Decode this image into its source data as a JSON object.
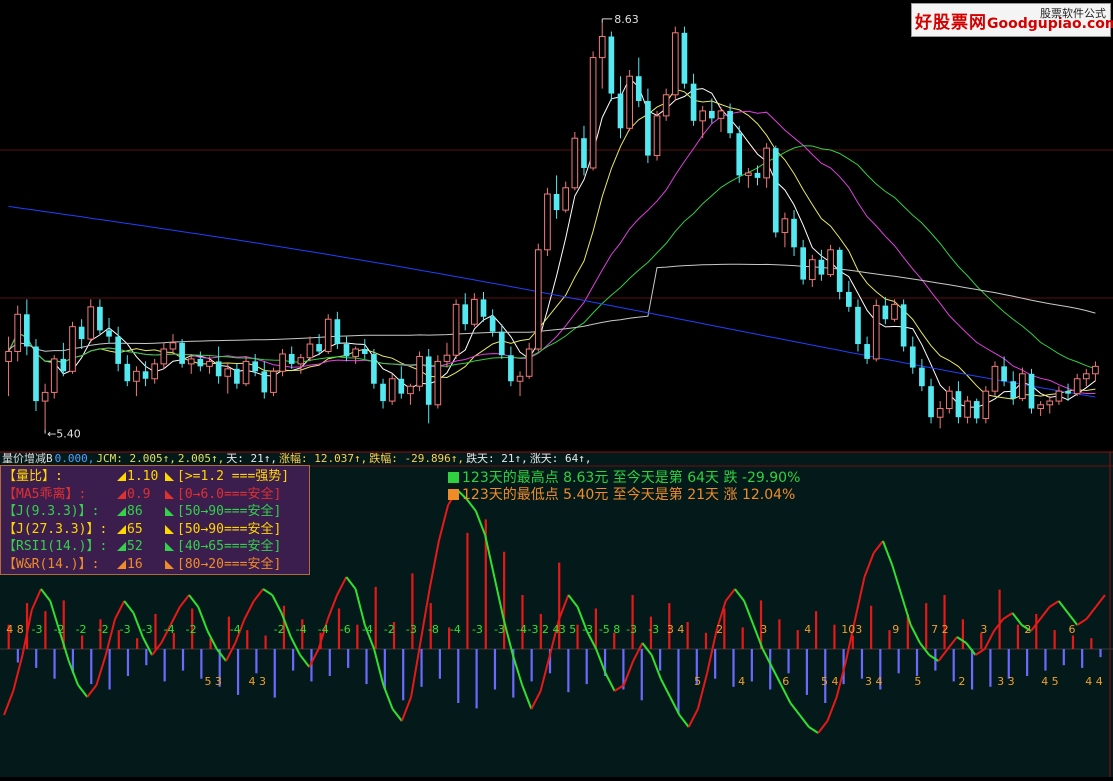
{
  "logo": {
    "text": "好股票网",
    "domain": "Goodgupiao.com",
    "tag": "股票软件公式"
  },
  "price_labels": {
    "high": "8.63",
    "low": "5.40"
  },
  "status_bar": {
    "items": [
      {
        "text": "量价增减B",
        "color": "#dddddd"
      },
      {
        "text": "0.000,",
        "color": "#4aa3ff"
      },
      {
        "text": "JCM: 2.005↑,",
        "color": "#e0e060"
      },
      {
        "text": "2.005↑,",
        "color": "#e0e060"
      },
      {
        "text": "天: 21↑,",
        "color": "#e8e8e8"
      },
      {
        "text": "涨幅: 12.037↑,",
        "color": "#ffd24a"
      },
      {
        "text": "跌幅: -29.896↑,",
        "color": "#ffd24a"
      },
      {
        "text": "跌天: 21↑,",
        "color": "#e8e8e8"
      },
      {
        "text": "涨天: 64↑,",
        "color": "#e8e8e8"
      }
    ]
  },
  "indicator_box": {
    "rows": [
      {
        "label": "【量比】:",
        "value": "1.10",
        "range": "[>=1.2 ===强势]",
        "color": "#ffd700"
      },
      {
        "label": "【MA5乖离】:",
        "value": "0.9",
        "range": "[0→6.0===安全]",
        "color": "#e03030"
      },
      {
        "label": "【J(9.3.3)】:",
        "value": "86",
        "range": "[50→90===安全]",
        "color": "#32d24a"
      },
      {
        "label": "【J(27.3.3)】:",
        "value": "65",
        "range": "[50→90===安全]",
        "color": "#ffd700"
      },
      {
        "label": "【RSI1(14.)】:",
        "value": "52",
        "range": "[40→65===安全]",
        "color": "#32d24a"
      },
      {
        "label": "【W&R(14.)】:",
        "value": "16",
        "range": "[80→20===安全]",
        "color": "#f08c28"
      }
    ]
  },
  "highlights": [
    {
      "text": "123天的最高点 8.63元 至今天是第 64天 跌 -29.90%",
      "color": "#30d040"
    },
    {
      "text": "123天的最低点 5.40元 至今天是第 21天 涨 12.04%",
      "color": "#f08c28"
    }
  ],
  "chart_data": [
    {
      "type": "candlestick",
      "x_count": 120,
      "ohlc": [
        [
          5.9,
          6.1,
          5.62,
          5.98
        ],
        [
          5.98,
          6.35,
          5.9,
          6.28
        ],
        [
          6.28,
          6.4,
          5.95,
          6.02
        ],
        [
          6.02,
          6.08,
          5.5,
          5.58
        ],
        [
          5.58,
          5.72,
          5.35,
          5.65
        ],
        [
          5.65,
          5.95,
          5.6,
          5.92
        ],
        [
          5.92,
          6.05,
          5.78,
          5.82
        ],
        [
          5.82,
          6.22,
          5.8,
          6.18
        ],
        [
          6.18,
          6.24,
          6.0,
          6.08
        ],
        [
          6.08,
          6.4,
          6.05,
          6.34
        ],
        [
          6.34,
          6.4,
          6.12,
          6.15
        ],
        [
          6.15,
          6.25,
          6.05,
          6.1
        ],
        [
          6.1,
          6.18,
          5.82,
          5.88
        ],
        [
          5.88,
          5.95,
          5.7,
          5.74
        ],
        [
          5.74,
          5.86,
          5.62,
          5.82
        ],
        [
          5.82,
          5.9,
          5.7,
          5.76
        ],
        [
          5.76,
          5.92,
          5.72,
          5.88
        ],
        [
          5.88,
          6.05,
          5.84,
          6.0
        ],
        [
          6.0,
          6.12,
          5.96,
          6.05
        ],
        [
          6.05,
          6.08,
          5.85,
          5.88
        ],
        [
          5.88,
          5.96,
          5.8,
          5.92
        ],
        [
          5.92,
          5.98,
          5.82,
          5.86
        ],
        [
          5.86,
          5.94,
          5.8,
          5.9
        ],
        [
          5.9,
          6.02,
          5.72,
          5.78
        ],
        [
          5.78,
          5.88,
          5.64,
          5.84
        ],
        [
          5.84,
          5.88,
          5.68,
          5.72
        ],
        [
          5.72,
          5.94,
          5.7,
          5.9
        ],
        [
          5.9,
          5.96,
          5.78,
          5.82
        ],
        [
          5.82,
          5.9,
          5.6,
          5.65
        ],
        [
          5.65,
          5.85,
          5.62,
          5.82
        ],
        [
          5.82,
          6.0,
          5.78,
          5.96
        ],
        [
          5.96,
          6.02,
          5.84,
          5.88
        ],
        [
          5.88,
          5.96,
          5.8,
          5.93
        ],
        [
          5.93,
          6.1,
          5.9,
          6.04
        ],
        [
          6.04,
          6.12,
          5.95,
          5.98
        ],
        [
          5.98,
          6.28,
          5.96,
          6.24
        ],
        [
          6.24,
          6.3,
          6.0,
          6.04
        ],
        [
          6.04,
          6.1,
          5.9,
          5.94
        ],
        [
          5.94,
          6.02,
          5.88,
          6.0
        ],
        [
          6.0,
          6.08,
          5.92,
          5.96
        ],
        [
          5.96,
          6.0,
          5.68,
          5.72
        ],
        [
          5.72,
          5.76,
          5.52,
          5.58
        ],
        [
          5.58,
          5.8,
          5.55,
          5.76
        ],
        [
          5.76,
          5.86,
          5.6,
          5.64
        ],
        [
          5.64,
          5.72,
          5.55,
          5.7
        ],
        [
          5.7,
          5.98,
          5.66,
          5.94
        ],
        [
          5.94,
          6.0,
          5.4,
          5.55
        ],
        [
          5.55,
          5.95,
          5.52,
          5.9
        ],
        [
          5.9,
          6.05,
          5.85,
          5.95
        ],
        [
          5.95,
          6.4,
          5.92,
          6.36
        ],
        [
          6.36,
          6.45,
          6.15,
          6.2
        ],
        [
          6.2,
          6.45,
          6.18,
          6.4
        ],
        [
          6.4,
          6.46,
          6.22,
          6.26
        ],
        [
          6.26,
          6.32,
          6.1,
          6.14
        ],
        [
          6.14,
          6.2,
          5.92,
          5.95
        ],
        [
          5.95,
          6.02,
          5.7,
          5.74
        ],
        [
          5.74,
          5.82,
          5.62,
          5.78
        ],
        [
          5.78,
          6.05,
          5.76,
          6.0
        ],
        [
          6.0,
          6.85,
          5.98,
          6.8
        ],
        [
          6.8,
          7.3,
          6.75,
          7.25
        ],
        [
          7.25,
          7.4,
          7.05,
          7.12
        ],
        [
          7.12,
          7.35,
          7.1,
          7.3
        ],
        [
          7.3,
          7.75,
          7.28,
          7.7
        ],
        [
          7.7,
          7.8,
          7.4,
          7.46
        ],
        [
          7.46,
          8.4,
          7.44,
          8.35
        ],
        [
          8.35,
          8.63,
          8.1,
          8.52
        ],
        [
          8.52,
          8.56,
          8.0,
          8.06
        ],
        [
          8.06,
          8.2,
          7.7,
          7.78
        ],
        [
          7.78,
          8.25,
          7.76,
          8.2
        ],
        [
          8.2,
          8.35,
          7.95,
          8.0
        ],
        [
          8.0,
          8.1,
          7.5,
          7.56
        ],
        [
          7.56,
          7.92,
          7.52,
          7.88
        ],
        [
          7.88,
          8.1,
          7.84,
          8.05
        ],
        [
          8.05,
          8.6,
          8.0,
          8.55
        ],
        [
          8.55,
          8.6,
          8.1,
          8.14
        ],
        [
          8.14,
          8.22,
          7.8,
          7.84
        ],
        [
          7.84,
          7.96,
          7.7,
          7.92
        ],
        [
          7.92,
          8.02,
          7.82,
          7.86
        ],
        [
          7.86,
          7.95,
          7.75,
          7.92
        ],
        [
          7.92,
          7.98,
          7.7,
          7.74
        ],
        [
          7.74,
          7.8,
          7.34,
          7.4
        ],
        [
          7.4,
          7.46,
          7.3,
          7.42
        ],
        [
          7.42,
          7.48,
          7.32,
          7.38
        ],
        [
          7.38,
          7.66,
          7.3,
          7.62
        ],
        [
          7.62,
          7.64,
          6.9,
          6.94
        ],
        [
          6.94,
          7.1,
          6.82,
          7.05
        ],
        [
          7.05,
          7.12,
          6.75,
          6.82
        ],
        [
          6.82,
          6.88,
          6.52,
          6.56
        ],
        [
          6.56,
          6.76,
          6.5,
          6.72
        ],
        [
          6.72,
          6.8,
          6.55,
          6.6
        ],
        [
          6.6,
          6.84,
          6.58,
          6.8
        ],
        [
          6.8,
          6.82,
          6.4,
          6.46
        ],
        [
          6.46,
          6.55,
          6.3,
          6.34
        ],
        [
          6.34,
          6.4,
          5.98,
          6.04
        ],
        [
          6.04,
          6.1,
          5.88,
          5.92
        ],
        [
          5.92,
          6.4,
          5.9,
          6.35
        ],
        [
          6.35,
          6.42,
          6.2,
          6.24
        ],
        [
          6.24,
          6.4,
          6.22,
          6.36
        ],
        [
          6.36,
          6.4,
          5.98,
          6.02
        ],
        [
          6.02,
          6.1,
          5.8,
          5.85
        ],
        [
          5.85,
          5.92,
          5.66,
          5.7
        ],
        [
          5.7,
          5.76,
          5.4,
          5.45
        ],
        [
          5.45,
          5.58,
          5.36,
          5.52
        ],
        [
          5.52,
          5.7,
          5.48,
          5.66
        ],
        [
          5.66,
          5.74,
          5.4,
          5.45
        ],
        [
          5.45,
          5.62,
          5.4,
          5.58
        ],
        [
          5.58,
          5.6,
          5.4,
          5.44
        ],
        [
          5.44,
          5.7,
          5.4,
          5.66
        ],
        [
          5.66,
          5.9,
          5.62,
          5.86
        ],
        [
          5.86,
          5.94,
          5.7,
          5.74
        ],
        [
          5.74,
          5.82,
          5.55,
          5.6
        ],
        [
          5.6,
          5.85,
          5.58,
          5.8
        ],
        [
          5.8,
          5.84,
          5.48,
          5.52
        ],
        [
          5.52,
          5.58,
          5.46,
          5.55
        ],
        [
          5.55,
          5.62,
          5.48,
          5.58
        ],
        [
          5.58,
          5.7,
          5.55,
          5.66
        ],
        [
          5.66,
          5.72,
          5.58,
          5.64
        ],
        [
          5.64,
          5.8,
          5.62,
          5.76
        ],
        [
          5.76,
          5.84,
          5.7,
          5.8
        ],
        [
          5.8,
          5.9,
          5.74,
          5.86
        ]
      ],
      "ma_colors": [
        "#ffffff",
        "#e8e860",
        "#e040e0",
        "#30d040",
        "#c8c8c8",
        "#2040ff"
      ],
      "ylim": [
        5.25,
        8.75
      ]
    },
    {
      "type": "bar+line",
      "bars": [
        18,
        -10,
        34,
        -14,
        28,
        -22,
        36,
        -18,
        10,
        -26,
        22,
        -30,
        14,
        -20,
        8,
        -12,
        26,
        -24,
        12,
        -16,
        30,
        -22,
        8,
        -28,
        24,
        -34,
        14,
        -18,
        10,
        -36,
        32,
        -16,
        22,
        -24,
        12,
        -20,
        30,
        -14,
        18,
        -26,
        46,
        -30,
        20,
        -38,
        56,
        -28,
        34,
        -22,
        16,
        -40,
        86,
        -44,
        96,
        -30,
        72,
        -36,
        40,
        -24,
        26,
        -18,
        64,
        -32,
        18,
        -26,
        30,
        -20,
        12,
        -30,
        40,
        -38,
        24,
        -16,
        34,
        -48,
        20,
        -26,
        12,
        -22,
        30,
        -28,
        16,
        -24,
        36,
        -30,
        22,
        -18,
        14,
        -34,
        28,
        -40,
        18,
        -26,
        10,
        -22,
        32,
        -30,
        14,
        -18,
        26,
        -20,
        34,
        -16,
        40,
        -24,
        22,
        -30,
        12,
        -28,
        44,
        -22,
        18,
        -20,
        26,
        -16,
        14,
        -12,
        10,
        -14,
        8,
        -6
      ],
      "line": [
        20,
        28,
        40,
        55,
        62,
        58,
        48,
        38,
        30,
        26,
        30,
        40,
        52,
        58,
        54,
        46,
        40,
        44,
        50,
        56,
        60,
        56,
        48,
        42,
        38,
        44,
        52,
        58,
        62,
        60,
        54,
        46,
        40,
        36,
        42,
        52,
        60,
        66,
        62,
        50,
        42,
        30,
        22,
        18,
        26,
        44,
        62,
        78,
        90,
        95,
        92,
        88,
        80,
        66,
        52,
        40,
        30,
        22,
        28,
        40,
        52,
        60,
        56,
        48,
        42,
        34,
        28,
        30,
        38,
        44,
        40,
        32,
        26,
        20,
        16,
        22,
        34,
        48,
        58,
        62,
        58,
        50,
        42,
        36,
        30,
        24,
        20,
        16,
        14,
        18,
        26,
        38,
        52,
        66,
        74,
        78,
        70,
        60,
        50,
        44,
        40,
        38,
        42,
        46,
        44,
        40,
        42,
        48,
        52,
        54,
        50,
        48,
        52,
        56,
        58,
        54,
        50,
        52,
        56,
        60
      ],
      "labels": [
        "4 8",
        "-3",
        "-2",
        "-2",
        "-2",
        "-3",
        "-3",
        "-4",
        "-2",
        "5 3",
        "-4",
        "4 3",
        "-2",
        "-4",
        "-4",
        "-6",
        "-4",
        "-2",
        "-3",
        "-8",
        "-4",
        "-3",
        "-3",
        "-4",
        "-3 2 4",
        "-3 5",
        "-3",
        "-5 8",
        "-3",
        "-3",
        "3 4",
        "5",
        "2",
        "4",
        "3",
        "6",
        "4",
        "5 4",
        "103",
        "3 4",
        "9",
        "5",
        "7 2",
        "2",
        "3",
        "3 3",
        "2",
        "4 5",
        "6",
        "4 4"
      ],
      "ylim": [
        0,
        100
      ]
    }
  ]
}
